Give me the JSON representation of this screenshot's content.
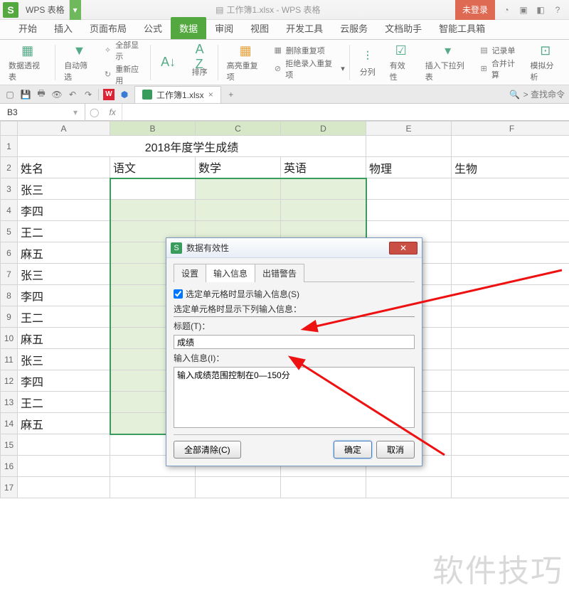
{
  "app": {
    "badge": "S",
    "name": "WPS 表格",
    "doc_title": "工作簿1.xlsx - WPS 表格",
    "login": "未登录"
  },
  "menu": {
    "items": [
      "开始",
      "插入",
      "页面布局",
      "公式",
      "数据",
      "审阅",
      "视图",
      "开发工具",
      "云服务",
      "文档助手",
      "智能工具箱"
    ],
    "active_index": 4
  },
  "ribbon": {
    "pivot": "数据透视表",
    "autofilter": "自动筛选",
    "show_all": "全部显示",
    "reapply": "重新应用",
    "sort": "排序",
    "highlight_dup": "高亮重复项",
    "remove_dup": "删除重复项",
    "reject_dup": "拒绝录入重复项",
    "text_to_cols": "分列",
    "validation": "有效性",
    "insert_dropdown": "插入下拉列表",
    "consolidate": "合并计算",
    "record_form": "记录单",
    "whatif": "模拟分析"
  },
  "doc_tab": {
    "name": "工作簿1.xlsx"
  },
  "search_hint": "查找命令",
  "name_box": "B3",
  "columns": [
    "A",
    "B",
    "C",
    "D",
    "E",
    "F"
  ],
  "rows": [
    "1",
    "2",
    "3",
    "4",
    "5",
    "6",
    "7",
    "8",
    "9",
    "10",
    "11",
    "12",
    "13",
    "14",
    "15",
    "16",
    "17"
  ],
  "sheet": {
    "title": "2018年度学生成绩",
    "headers": [
      "姓名",
      "语文",
      "数学",
      "英语",
      "物理",
      "生物"
    ],
    "names": [
      "张三",
      "李四",
      "王二",
      "麻五",
      "张三",
      "李四",
      "王二",
      "麻五",
      "张三",
      "李四",
      "王二",
      "麻五"
    ]
  },
  "dialog": {
    "title": "数据有效性",
    "tabs": [
      "设置",
      "输入信息",
      "出错警告"
    ],
    "active_tab": 1,
    "checkbox_label": "选定单元格时显示输入信息(S)",
    "section_label": "选定单元格时显示下列输入信息：",
    "title_label": "标题(T)：",
    "title_value": "成绩",
    "msg_label": "输入信息(I)：",
    "msg_value": "输入成绩范围控制在0—150分",
    "clear_all": "全部清除(C)",
    "ok": "确定",
    "cancel": "取消"
  },
  "watermark": "软件技巧"
}
